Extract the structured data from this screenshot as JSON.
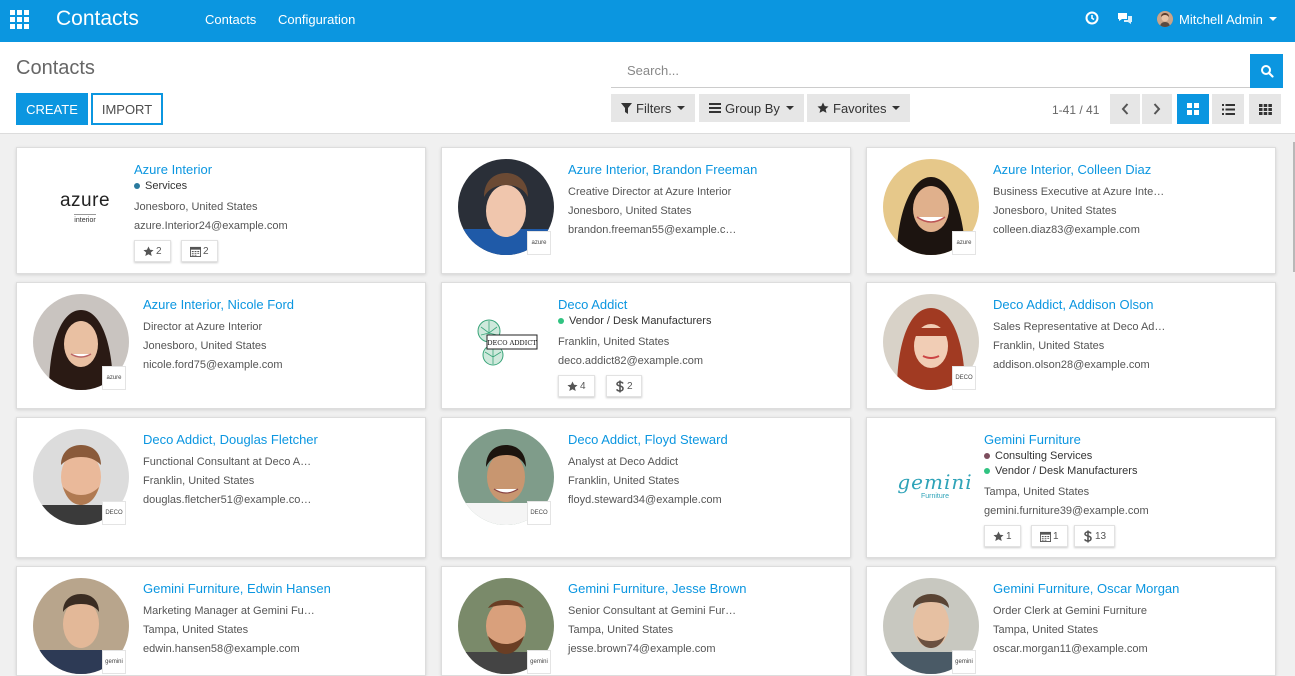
{
  "navbar": {
    "title": "Contacts",
    "links": [
      "Contacts",
      "Configuration"
    ],
    "user_name": "Mitchell Admin",
    "icons": [
      "apps-icon",
      "clock-icon",
      "chat-icon",
      "chevron-down-icon"
    ]
  },
  "control": {
    "breadcrumb": "Contacts",
    "create_label": "Create",
    "import_label": "Import",
    "search_placeholder": "Search...",
    "filters_label": "Filters",
    "groupby_label": "Group By",
    "favorites_label": "Favorites",
    "pager": "1-41 / 41"
  },
  "colors": {
    "brand": "#0b96e0",
    "tag_blue": "#2a7a9e",
    "tag_green": "#30c381",
    "tag_purple": "#7d4e5e"
  },
  "cards": [
    {
      "name": "Azure Interior",
      "tags": [
        {
          "label": "Services",
          "color": "#2a7a9e"
        }
      ],
      "lines": [
        "Jonesboro, United States",
        "azure.Interior24@example.com"
      ],
      "logo": "azure",
      "logo_text": "azure",
      "logo_sub": "interior",
      "badges": [
        {
          "icon": "star-icon",
          "count": "2"
        },
        {
          "icon": "calendar-icon",
          "count": "2"
        }
      ]
    },
    {
      "name": "Azure Interior, Brandon Freeman",
      "lines": [
        "Creative Director at Azure Interior",
        "Jonesboro, United States",
        "brandon.freeman55@example.c…"
      ],
      "badge_text": "azure"
    },
    {
      "name": "Azure Interior, Colleen Diaz",
      "lines": [
        "Business Executive at Azure Inte…",
        "Jonesboro, United States",
        "colleen.diaz83@example.com"
      ],
      "badge_text": "azure"
    },
    {
      "name": "Azure Interior, Nicole Ford",
      "lines": [
        "Director at Azure Interior",
        "Jonesboro, United States",
        "nicole.ford75@example.com"
      ],
      "badge_text": "azure"
    },
    {
      "name": "Deco Addict",
      "tags": [
        {
          "label": "Vendor / Desk Manufacturers",
          "color": "#30c381"
        }
      ],
      "lines": [
        "Franklin, United States",
        "deco.addict82@example.com"
      ],
      "logo": "deco",
      "logo_text": "DECO ADDICT",
      "badges": [
        {
          "icon": "star-icon",
          "count": "4"
        },
        {
          "icon": "dollar-icon",
          "count": "2"
        }
      ]
    },
    {
      "name": "Deco Addict, Addison Olson",
      "lines": [
        "Sales Representative at Deco Ad…",
        "Franklin, United States",
        "addison.olson28@example.com"
      ],
      "badge_text": "DECO"
    },
    {
      "name": "Deco Addict, Douglas Fletcher",
      "lines": [
        "Functional Consultant at Deco A…",
        "Franklin, United States",
        "douglas.fletcher51@example.co…"
      ],
      "badge_text": "DECO"
    },
    {
      "name": "Deco Addict, Floyd Steward",
      "lines": [
        "Analyst at Deco Addict",
        "Franklin, United States",
        "floyd.steward34@example.com"
      ],
      "badge_text": "DECO"
    },
    {
      "name": "Gemini Furniture",
      "tags": [
        {
          "label": "Consulting Services",
          "color": "#7d4e5e"
        },
        {
          "label": "Vendor / Desk Manufacturers",
          "color": "#30c381"
        }
      ],
      "lines": [
        "Tampa, United States",
        "gemini.furniture39@example.com"
      ],
      "logo": "gemini",
      "logo_text": "gemini",
      "logo_sub": "Furniture",
      "badges": [
        {
          "icon": "star-icon",
          "count": "1"
        },
        {
          "icon": "calendar-icon",
          "count": "1"
        },
        {
          "icon": "dollar-icon",
          "count": "13"
        }
      ]
    },
    {
      "name": "Gemini Furniture, Edwin Hansen",
      "lines": [
        "Marketing Manager at Gemini Fu…",
        "Tampa, United States",
        "edwin.hansen58@example.com"
      ],
      "badge_text": "gemini"
    },
    {
      "name": "Gemini Furniture, Jesse Brown",
      "lines": [
        "Senior Consultant at Gemini Fur…",
        "Tampa, United States",
        "jesse.brown74@example.com"
      ],
      "badge_text": "gemini"
    },
    {
      "name": "Gemini Furniture, Oscar Morgan",
      "lines": [
        "Order Clerk at Gemini Furniture",
        "Tampa, United States",
        "oscar.morgan11@example.com"
      ],
      "badge_text": "gemini"
    }
  ]
}
